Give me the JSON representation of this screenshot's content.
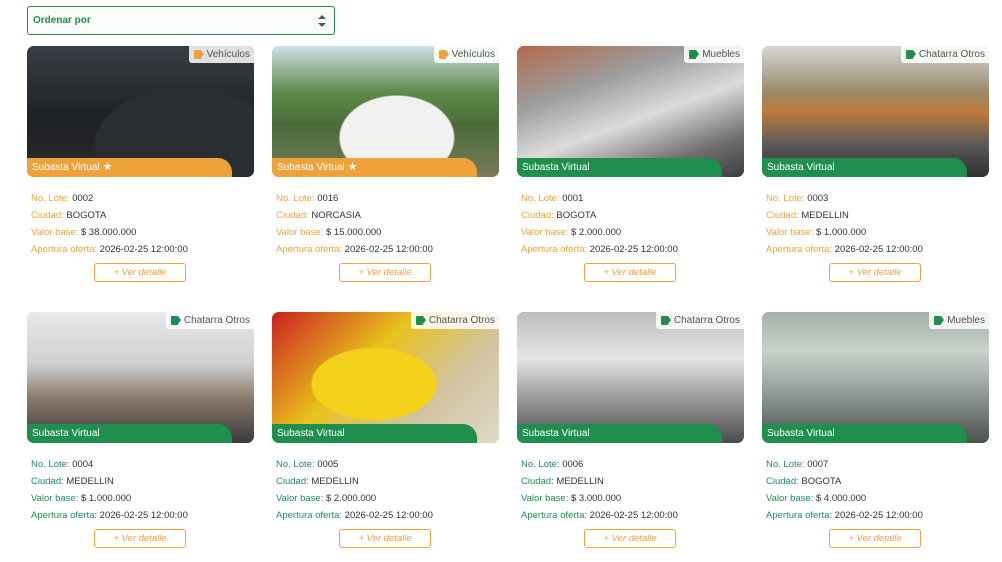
{
  "sort": {
    "label": "Ordenar por"
  },
  "labels": {
    "lote": "No. Lote:",
    "ciudad": "Ciudad:",
    "valor": "Valor base:",
    "apertura": "Apertura oferta:",
    "detail": "+ Ver detalle"
  },
  "lots": [
    {
      "category": "Vehículos",
      "banner": "Subasta Virtual",
      "featured": true,
      "theme": "orange",
      "lote": "0002",
      "ciudad": "BOGOTA",
      "valor": "$ 38.000.000",
      "apertura": "2026-02-25 12:00:00"
    },
    {
      "category": "Vehículos",
      "banner": "Subasta Virtual",
      "featured": true,
      "theme": "orange",
      "lote": "0016",
      "ciudad": "NORCASIA",
      "valor": "$ 15.000.000",
      "apertura": "2026-02-25 12:00:00"
    },
    {
      "category": "Muebles",
      "banner": "Subasta Virtual",
      "featured": false,
      "theme": "green",
      "lote": "0001",
      "ciudad": "BOGOTA",
      "valor": "$ 2.000.000",
      "apertura": "2026-02-25 12:00:00"
    },
    {
      "category": "Chatarra Otros",
      "banner": "Subasta Virtual",
      "featured": false,
      "theme": "green",
      "lote": "0003",
      "ciudad": "MEDELLIN",
      "valor": "$ 1.000.000",
      "apertura": "2026-02-25 12:00:00"
    },
    {
      "category": "Chatarra Otros",
      "banner": "Subasta Virtual",
      "featured": false,
      "theme": "green",
      "lote": "0004",
      "ciudad": "MEDELLIN",
      "valor": "$ 1.000.000",
      "apertura": "2026-02-25 12:00:00"
    },
    {
      "category": "Chatarra Otros",
      "banner": "Subasta Virtual",
      "featured": false,
      "theme": "green",
      "lote": "0005",
      "ciudad": "MEDELLIN",
      "valor": "$ 2.000.000",
      "apertura": "2026-02-25 12:00:00"
    },
    {
      "category": "Chatarra Otros",
      "banner": "Subasta Virtual",
      "featured": false,
      "theme": "green",
      "lote": "0006",
      "ciudad": "MEDELLIN",
      "valor": "$ 3.000.000",
      "apertura": "2026-02-25 12:00:00"
    },
    {
      "category": "Muebles",
      "banner": "Subasta Virtual",
      "featured": false,
      "theme": "green",
      "lote": "0007",
      "ciudad": "BOGOTA",
      "valor": "$ 4.000.000",
      "apertura": "2026-02-25 12:00:00"
    }
  ]
}
